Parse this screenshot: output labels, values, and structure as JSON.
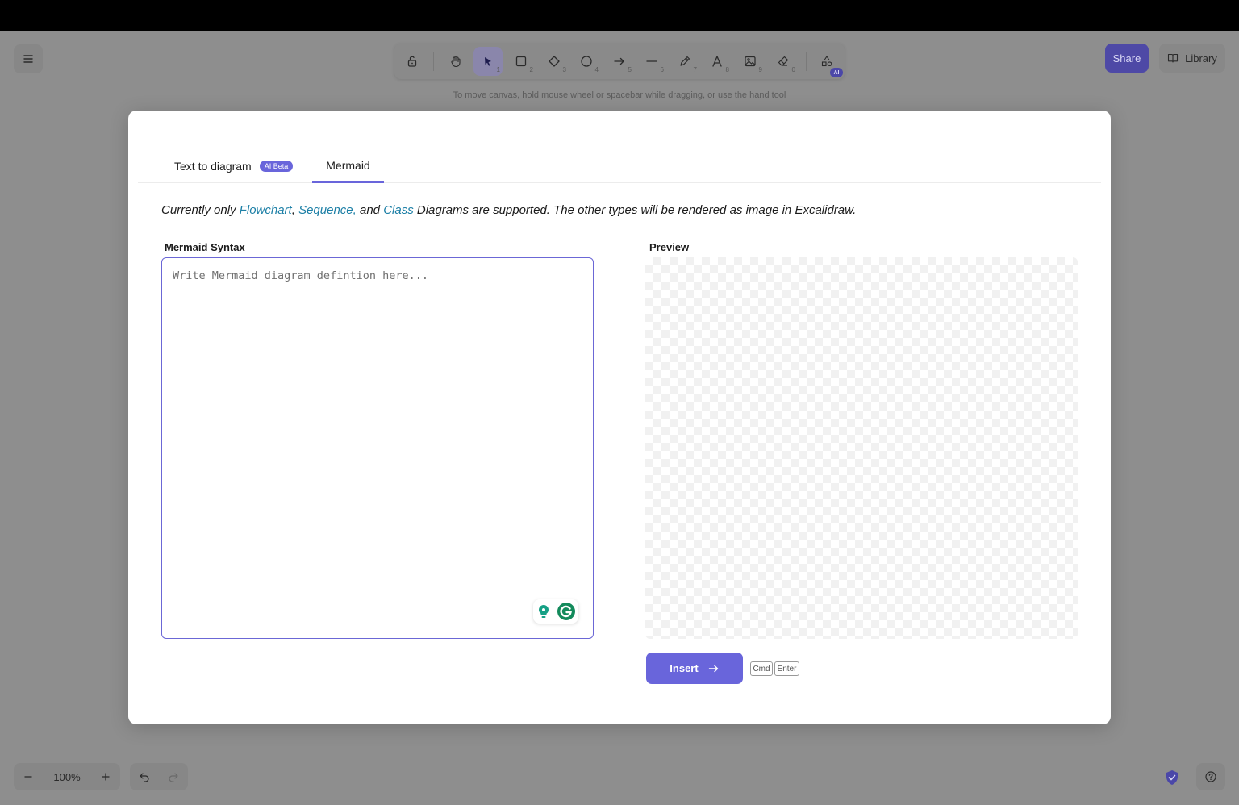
{
  "toolbar": {
    "hint": "To move canvas, hold mouse wheel or spacebar while dragging, or use the hand tool",
    "tools": [
      {
        "name": "lock",
        "num": ""
      },
      {
        "name": "hand",
        "num": ""
      },
      {
        "name": "selection",
        "num": "1"
      },
      {
        "name": "rectangle",
        "num": "2"
      },
      {
        "name": "diamond",
        "num": "3"
      },
      {
        "name": "ellipse",
        "num": "4"
      },
      {
        "name": "arrow",
        "num": "5"
      },
      {
        "name": "line",
        "num": "6"
      },
      {
        "name": "draw",
        "num": "7"
      },
      {
        "name": "text",
        "num": "8"
      },
      {
        "name": "image",
        "num": "9"
      },
      {
        "name": "eraser",
        "num": "0"
      }
    ],
    "ai_badge": "AI"
  },
  "header": {
    "share_label": "Share",
    "library_label": "Library"
  },
  "footer": {
    "zoom_value": "100%"
  },
  "dialog": {
    "tabs": {
      "text_to_diagram": "Text to diagram",
      "ai_badge": "AI Beta",
      "mermaid": "Mermaid"
    },
    "info": {
      "prefix": "Currently only ",
      "flowchart": "Flowchart",
      "comma1": ", ",
      "sequence": "Sequence,",
      "and": " and ",
      "class": "Class",
      "suffix": " Diagrams are supported. The other types will be rendered as image in Excalidraw."
    },
    "syntax_label": "Mermaid Syntax",
    "preview_label": "Preview",
    "editor_placeholder": "Write Mermaid diagram defintion here...",
    "insert_label": "Insert",
    "kbd_cmd": "Cmd",
    "kbd_enter": "Enter"
  },
  "colors": {
    "accent": "#6965db",
    "link": "#1c7fa6"
  }
}
